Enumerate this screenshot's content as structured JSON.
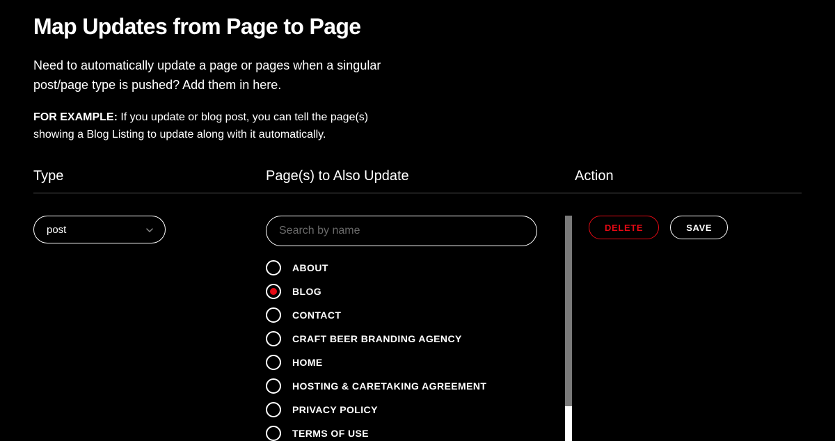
{
  "title": "Map Updates from Page to Page",
  "subtitle": "Need to automatically update a page or pages when a singular post/page type is pushed? Add them in here.",
  "example_label": "FOR EXAMPLE:",
  "example_text": " If you update or blog post, you can tell the page(s) showing a Blog Listing to update along with it automatically.",
  "columns": {
    "type": "Type",
    "pages": "Page(s) to Also Update",
    "action": "Action"
  },
  "type_select": {
    "value": "post"
  },
  "search": {
    "placeholder": "Search by name",
    "value": ""
  },
  "pages": [
    {
      "label": "ABOUT",
      "selected": false
    },
    {
      "label": "BLOG",
      "selected": true
    },
    {
      "label": "CONTACT",
      "selected": false
    },
    {
      "label": "CRAFT BEER BRANDING AGENCY",
      "selected": false
    },
    {
      "label": "HOME",
      "selected": false
    },
    {
      "label": "HOSTING & CARETAKING AGREEMENT",
      "selected": false
    },
    {
      "label": "PRIVACY POLICY",
      "selected": false
    },
    {
      "label": "TERMS OF USE",
      "selected": false
    }
  ],
  "actions": {
    "delete": "DELETE",
    "save": "SAVE"
  },
  "colors": {
    "accent": "#e50914"
  }
}
